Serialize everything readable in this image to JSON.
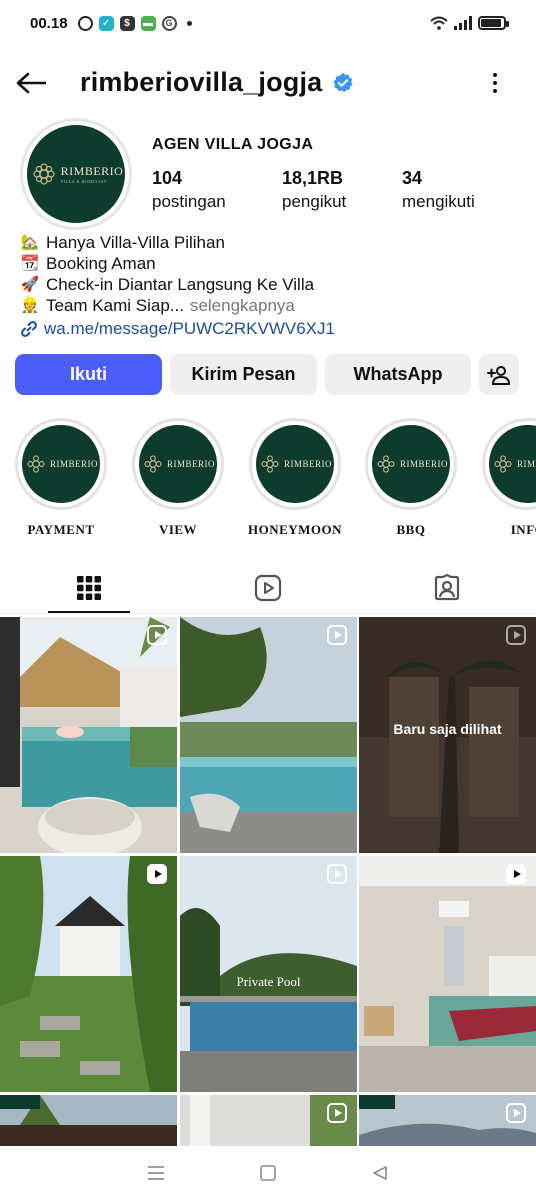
{
  "status_bar": {
    "time": "00.18"
  },
  "header": {
    "username": "rimberiovilla_jogja"
  },
  "profile": {
    "display_name": "AGEN VILLA JOGJA",
    "logo_text": "RIMBERIO",
    "logo_sub": "VILLA & HOMESTAY",
    "stats": [
      {
        "value": "104",
        "label": "postingan"
      },
      {
        "value": "18,1RB",
        "label": "pengikut"
      },
      {
        "value": "34",
        "label": "mengikuti"
      }
    ],
    "bio": [
      {
        "emoji": "🏡",
        "text": "Hanya Villa-Villa Pilihan"
      },
      {
        "emoji": "📆",
        "text": "Booking Aman"
      },
      {
        "emoji": "🚀",
        "text": "Check-in Diantar Langsung Ke Villa"
      },
      {
        "emoji": "👷",
        "text": "Team Kami Siap..."
      }
    ],
    "more_label": "selengkapnya",
    "link": "wa.me/message/PUWC2RKVWV6XJ1"
  },
  "buttons": {
    "follow": "Ikuti",
    "message": "Kirim Pesan",
    "whatsapp": "WhatsApp"
  },
  "highlights": [
    {
      "label": "PAYMENT"
    },
    {
      "label": "VIEW"
    },
    {
      "label": "HONEYMOON"
    },
    {
      "label": "BBQ"
    },
    {
      "label": "INFO"
    }
  ],
  "grid": {
    "seen_label": "Baru saja dilihat",
    "pool_caption": "Private Pool"
  },
  "colors": {
    "accent": "#4a5df9",
    "logo_bg": "#0d3b2e",
    "link": "#1f4d9a"
  }
}
